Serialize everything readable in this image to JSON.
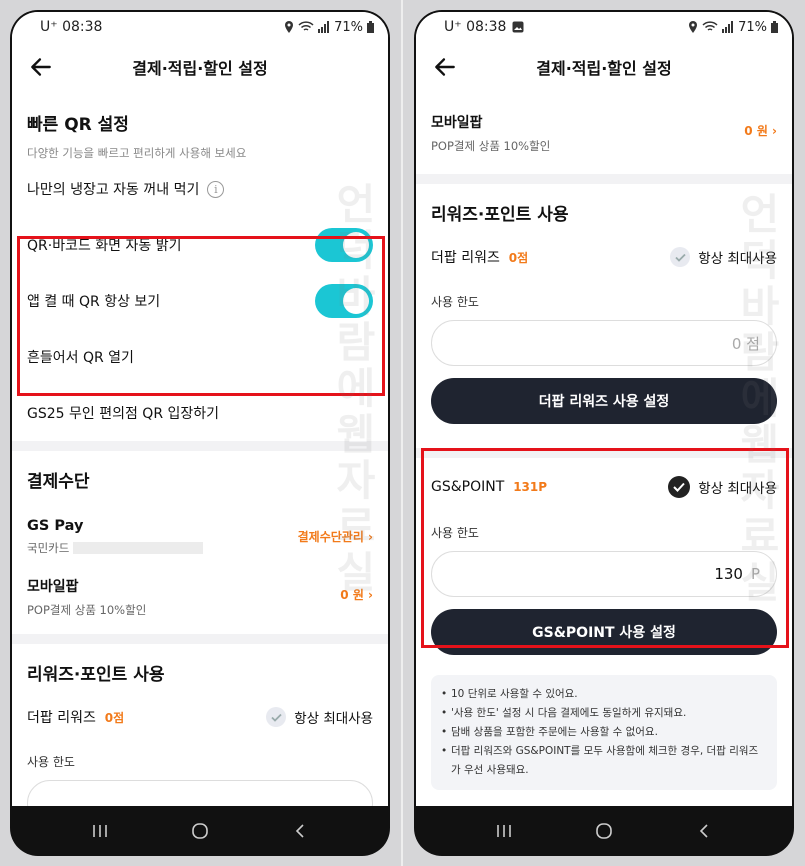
{
  "left": {
    "status": {
      "time": "U⁺ 08:38",
      "battery": "71%"
    },
    "title": "결제·적립·할인 설정",
    "qr": {
      "heading": "빠른 QR 설정",
      "subtitle": "다양한 기능을 빠르고 편리하게 사용해 보세요",
      "fridge_label": "나만의 냉장고 자동 꺼내 먹기",
      "auto_bright_label": "QR·바코드 화면 자동 밝기",
      "auto_bright_on": true,
      "always_qr_label": "앱 켤 때 QR 항상 보기",
      "always_qr_on": true,
      "shake_label": "흔들어서 QR 열기",
      "gs25_label": "GS25 무인 편의점 QR 입장하기"
    },
    "payment": {
      "heading": "결제수단",
      "gspay_label": "GS Pay",
      "gspay_card": "국민카드",
      "manage_link": "결제수단관리",
      "mobile_label": "모바일팝",
      "mobile_sub": "POP결제 상품 10%할인",
      "mobile_value": "0 원"
    },
    "rewards": {
      "heading": "리워즈·포인트 사용",
      "label": "더팝 리워즈",
      "points": "0점",
      "always_max": "항상 최대사용",
      "limit_label": "사용 한도"
    }
  },
  "right": {
    "status": {
      "time": "U⁺ 08:38",
      "battery": "71%"
    },
    "title": "결제·적립·할인 설정",
    "mobile": {
      "label": "모바일팝",
      "sub": "POP결제 상품 10%할인",
      "value": "0 원"
    },
    "rewards": {
      "heading": "리워즈·포인트 사용",
      "label": "더팝 리워즈",
      "points": "0점",
      "always_max": "항상 최대사용",
      "limit_label": "사용 한도",
      "limit_value": "0 점",
      "button": "더팝 리워즈 사용 설정"
    },
    "gspoint": {
      "label": "GS&POINT",
      "points": "131P",
      "always_max": "항상 최대사용",
      "limit_label": "사용 한도",
      "limit_value": "130",
      "limit_unit": "P",
      "button": "GS&POINT 사용 설정"
    },
    "notes": [
      "10 단위로 사용할 수 있어요.",
      "'사용 한도' 설정 시 다음 결제에도 동일하게 유지돼요.",
      "담배 상품을 포함한 주문에는 사용할 수 없어요.",
      "더팝 리워즈와 GS&POINT를 모두 사용함에 체크한 경우, 더팝 리워즈가 우선 사용돼요."
    ]
  },
  "colors": {
    "accent_toggle": "#1bc6d4",
    "orange": "#f27a1a",
    "dark_button": "#1f2430",
    "highlight": "#e5121a"
  },
  "watermark": "언덕바람에웹자료실"
}
